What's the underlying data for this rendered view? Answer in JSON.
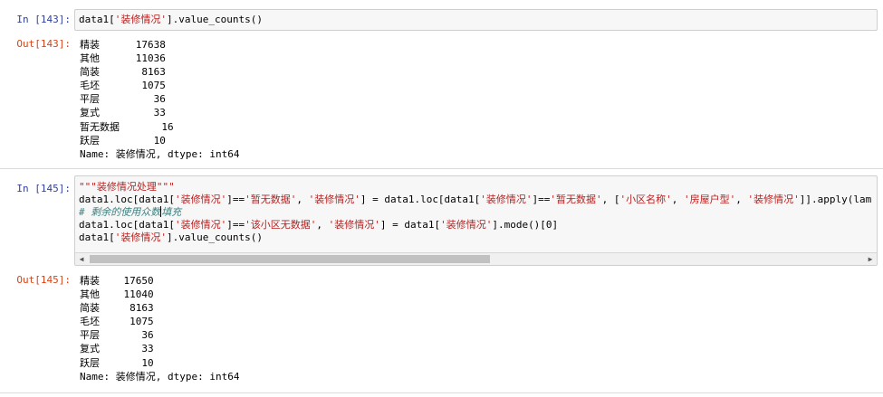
{
  "cell1": {
    "in_prompt": "In  [143]:",
    "out_prompt": "Out[143]:",
    "code": {
      "prefix": "data1[",
      "str": "'装修情况'",
      "suffix": "].value_counts()"
    },
    "output_lines": [
      "精装      17638",
      "其他      11036",
      "简装       8163",
      "毛坯       1075",
      "平层         36",
      "复式         33",
      "暂无数据       16",
      "跃层         10",
      "Name: 装修情况, dtype: int64"
    ]
  },
  "cell2": {
    "in_prompt": "In  [145]:",
    "out_prompt": "Out[145]:",
    "code": {
      "l1": "\"\"\"装修情况处理\"\"\"",
      "l2": {
        "a": "data1.loc[data1[",
        "b": "'装修情况'",
        "c": "]==",
        "d": "'暂无数据'",
        "e": ", ",
        "f": "'装修情况'",
        "g": "] = data1.loc[data1[",
        "h": "'装修情况'",
        "i": "]==",
        "j": "'暂无数据'",
        "k": ", [",
        "l": "'小区名称'",
        "m": ", ",
        "n": "'房屋户型'",
        "o": ", ",
        "p": "'装修情况'",
        "q": "]].apply(lam"
      },
      "l3a": "# 剩余的使用众数",
      "l3b": "填充",
      "l4": {
        "a": "data1.loc[data1[",
        "b": "'装修情况'",
        "c": "]==",
        "d": "'该小区无数据'",
        "e": ", ",
        "f": "'装修情况'",
        "g": "] = data1[",
        "h": "'装修情况'",
        "i": "].mode()[0]"
      },
      "l5": {
        "a": "data1[",
        "b": "'装修情况'",
        "c": "].value_counts()"
      }
    },
    "output_lines": [
      "精装    17650",
      "其他    11040",
      "简装     8163",
      "毛坯     1075",
      "平层       36",
      "复式       33",
      "跃层       10",
      "Name: 装修情况, dtype: int64"
    ]
  },
  "scrollbar": {
    "left_arrow": "◀",
    "right_arrow": "▶"
  }
}
